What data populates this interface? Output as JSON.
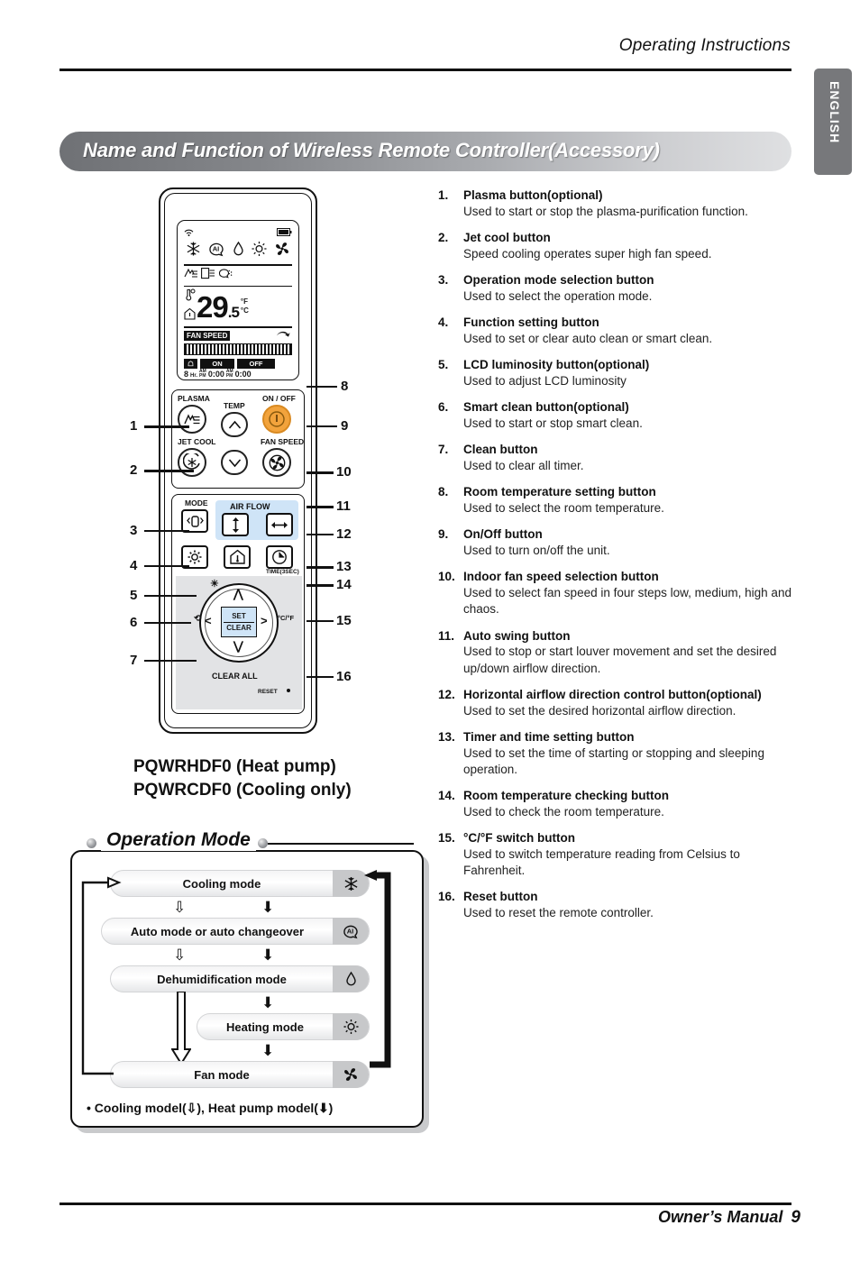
{
  "header": {
    "running_head": "Operating Instructions",
    "language_tab": "ENGLISH",
    "banner_title": "Name and Function of Wireless Remote Controller(Accessory)"
  },
  "remote": {
    "lcd": {
      "temperature": "29",
      "temperature_decimal": ".5",
      "unit_f": "°F",
      "unit_c": "°C",
      "fan_speed_label": "FAN SPEED",
      "timer_on": "ON",
      "timer_off": "OFF",
      "sleep_hours": "8",
      "hours_label": "Hr.",
      "time_on": "0:00",
      "time_off": "0:00",
      "am_label": "AM",
      "pm_label": "PM",
      "signal_icon": "signal-icon",
      "battery_icon": "battery-icon",
      "mode_icons": [
        "snowflake-icon",
        "auto-ai-icon",
        "droplet-icon",
        "sun-icon",
        "fan-icon"
      ],
      "func_icons": [
        "plasma-icon",
        "filter-icon",
        "airclean-icon"
      ],
      "swing_icon": "swing-arrow-icon",
      "room_icon": "home-icon",
      "set-temp_icon": "thermometer-icon"
    },
    "labels": {
      "plasma": "PLASMA",
      "jet_cool": "JET COOL",
      "temp": "TEMP",
      "on_off": "ON / OFF",
      "fan_speed": "FAN SPEED",
      "mode": "MODE",
      "air_flow": "AIR FLOW",
      "time_sec": "TIME(3SEC)",
      "set": "SET",
      "clear": "CLEAR",
      "clear_all": "CLEAR ALL",
      "reset": "RESET",
      "cf_switch": "°C/°F"
    },
    "callouts_left": [
      "1",
      "2",
      "3",
      "4",
      "5",
      "6",
      "7"
    ],
    "callouts_right": [
      "8",
      "9",
      "10",
      "11",
      "12",
      "13",
      "14",
      "15",
      "16"
    ],
    "model_line1": "PQWRHDF0 (Heat pump)",
    "model_line2": "PQWRCDF0 (Cooling only)"
  },
  "operation_mode": {
    "title": "Operation Mode",
    "rows": [
      {
        "label": "Cooling mode",
        "icon": "snowflake-icon"
      },
      {
        "label": "Auto mode or auto changeover",
        "icon": "auto-ai-icon"
      },
      {
        "label": "Dehumidification mode",
        "icon": "droplet-icon"
      },
      {
        "label": "Heating mode",
        "icon": "sun-icon"
      },
      {
        "label": "Fan mode",
        "icon": "fan-icon"
      }
    ],
    "note": "• Cooling model(⇩), Heat pump model(⬇)"
  },
  "functions": [
    {
      "n": "1.",
      "title": "Plasma button(optional)",
      "desc": "Used to start or stop the plasma-purification function."
    },
    {
      "n": "2.",
      "title": "Jet cool button",
      "desc": "Speed cooling operates super high fan speed."
    },
    {
      "n": "3.",
      "title": "Operation mode selection button",
      "desc": "Used to select the operation mode."
    },
    {
      "n": "4.",
      "title": "Function setting button",
      "desc": "Used to set or clear auto clean or smart clean."
    },
    {
      "n": "5.",
      "title": "LCD luminosity button(optional)",
      "desc": "Used to adjust LCD luminosity"
    },
    {
      "n": "6.",
      "title": "Smart clean button(optional)",
      "desc": "Used to start or stop smart clean."
    },
    {
      "n": "7.",
      "title": "Clean button",
      "desc": "Used to clear all timer."
    },
    {
      "n": "8.",
      "title": "Room temperature setting button",
      "desc": "Used to select the room temperature."
    },
    {
      "n": "9.",
      "title": "On/Off button",
      "desc": "Used to turn on/off the unit."
    },
    {
      "n": "10.",
      "title": "Indoor fan speed selection button",
      "desc": "Used to select fan speed in four steps low, medium, high and chaos."
    },
    {
      "n": "11.",
      "title": "Auto swing button",
      "desc": "Used to stop or start louver movement and set the desired up/down airflow direction."
    },
    {
      "n": "12.",
      "title": "Horizontal airflow direction control button(optional)",
      "desc": "Used to set the desired horizontal airflow direction."
    },
    {
      "n": "13.",
      "title": "Timer and time setting button",
      "desc": "Used to set the time of starting or stopping and sleeping operation."
    },
    {
      "n": "14.",
      "title": "Room temperature checking button",
      "desc": "Used to check the room temperature."
    },
    {
      "n": "15.",
      "title": "°C/°F switch button",
      "desc": "Used to switch temperature reading from Celsius to Fahrenheit."
    },
    {
      "n": "16.",
      "title": "Reset button",
      "desc": "Used to reset the remote controller."
    }
  ],
  "footer": {
    "label": "Owner’s Manual",
    "page": "9"
  },
  "colors": {
    "banner_dark": "#6f7175",
    "banner_light": "#dfe0e2",
    "tab_gray": "#77787b",
    "accent_orange": "#f2a33c",
    "airflow_blue": "#cfe4f7"
  }
}
